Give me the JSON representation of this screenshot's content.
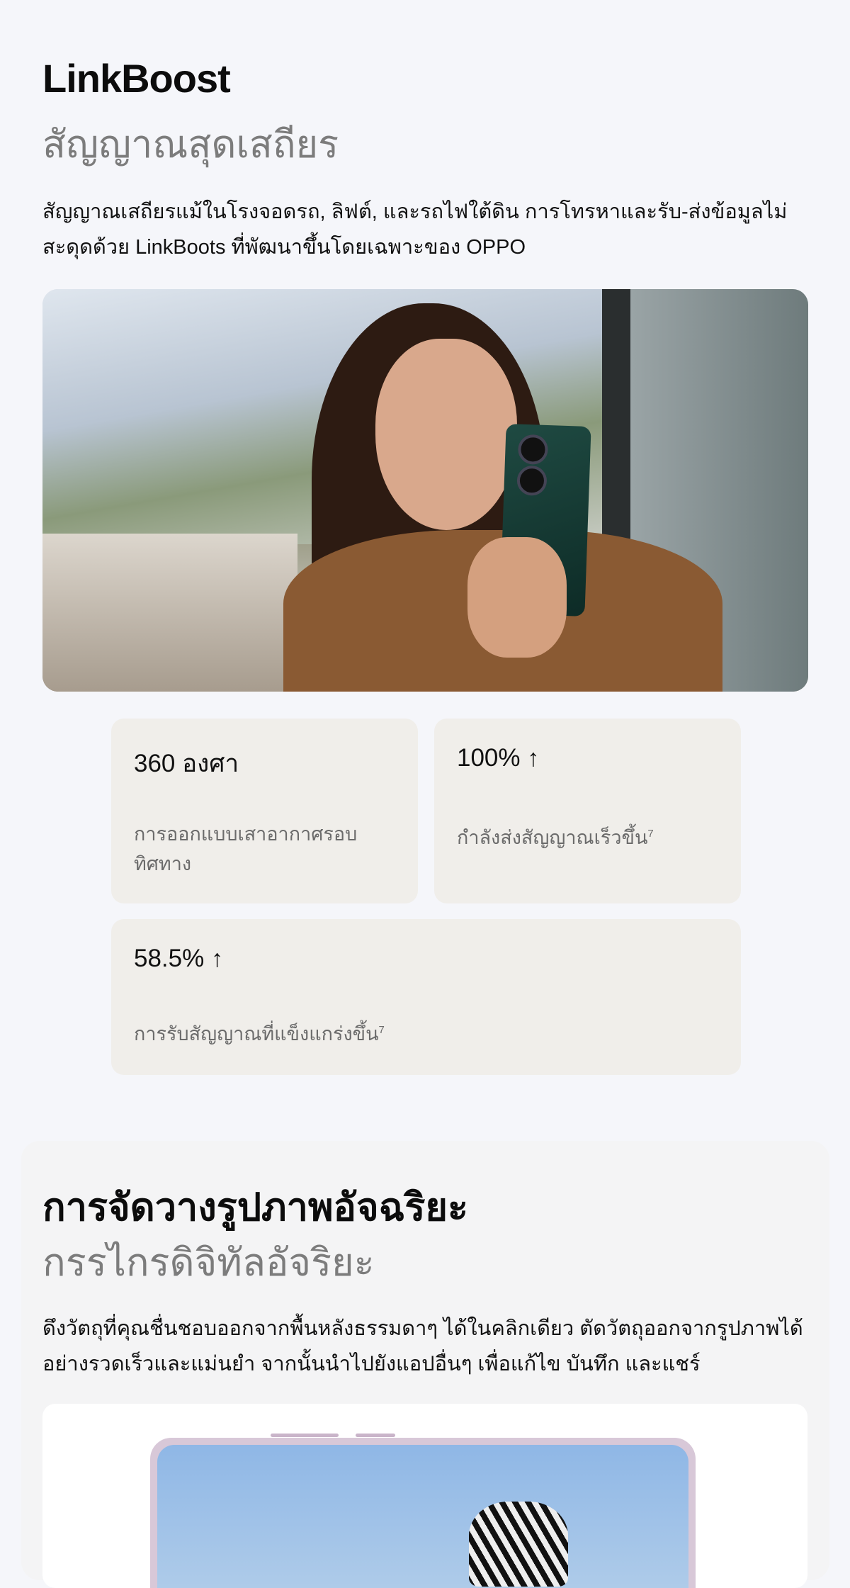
{
  "linkboost": {
    "title": "LinkBoost",
    "subtitle": "สัญญาณสุดเสถียร",
    "description": "สัญญาณเสถียรแม้ในโรงจอดรถ, ลิฟต์, และรถไฟใต้ดิน การโทรหาและรับ-ส่งข้อมูลไม่สะดุดด้วย LinkBoots ที่พัฒนาขึ้นโดยเฉพาะของ OPPO",
    "stats": [
      {
        "value": "360 องศา",
        "label": "การออกแบบเสาอากาศรอบทิศทาง",
        "arrow": ""
      },
      {
        "value": "100%",
        "label": "กำลังส่งสัญญาณเร็วขึ้น",
        "arrow": "↑",
        "note": "7"
      },
      {
        "value": "58.5%",
        "label": "การรับสัญญาณที่แข็งแกร่งขึ้น",
        "arrow": "↑",
        "note": "7"
      }
    ]
  },
  "smart_image": {
    "title": "การจัดวางรูปภาพอัจฉริยะ",
    "subtitle": "กรรไกรดิจิทัลอัจริยะ",
    "description": "ดึงวัตถุที่คุณชื่นชอบออกจากพื้นหลังธรรมดาๆ ได้ในคลิกเดียว ตัดวัตถุออกจากรูปภาพได้อย่างรวดเร็วและแม่นยำ จากนั้นนำไปยังแอปอื่นๆ เพื่อแก้ไข บันทึก และแชร์"
  },
  "colors": {
    "page_bg": "#f5f6fa",
    "card_bg": "#f0eeea",
    "muted_text": "#7c7c7c"
  }
}
